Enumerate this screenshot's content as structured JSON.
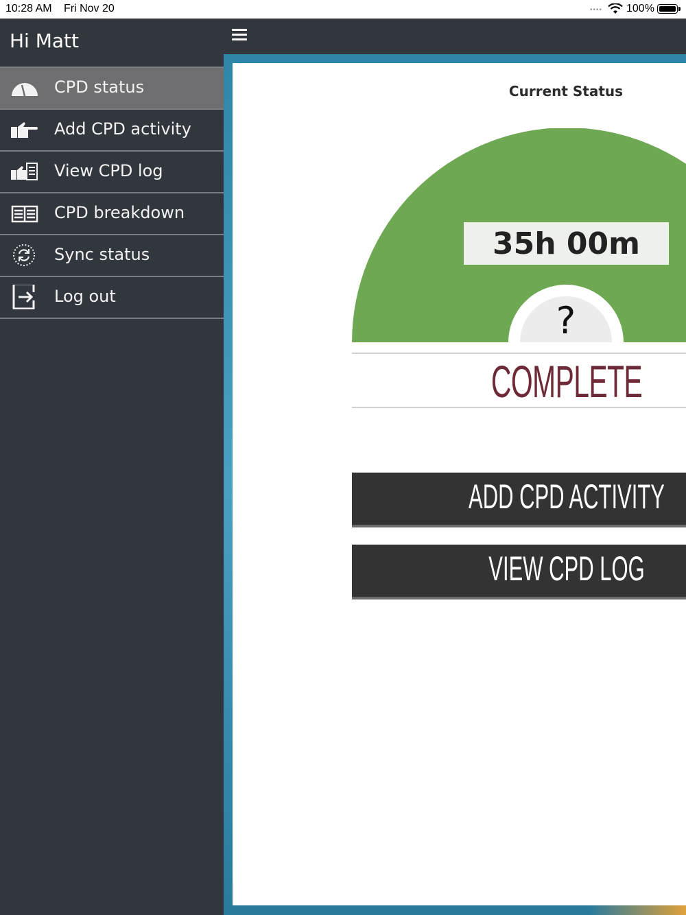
{
  "status_bar": {
    "time": "10:28 AM",
    "date": "Fri Nov 20",
    "battery": "100%"
  },
  "sidebar": {
    "greeting": "Hi Matt",
    "items": [
      {
        "label": "CPD status",
        "icon": "gauge-icon"
      },
      {
        "label": "Add CPD activity",
        "icon": "pointing-hand-icon"
      },
      {
        "label": "View CPD log",
        "icon": "hand-log-icon"
      },
      {
        "label": "CPD breakdown",
        "icon": "table-icon"
      },
      {
        "label": "Sync status",
        "icon": "sync-icon"
      },
      {
        "label": "Log out",
        "icon": "logout-icon"
      }
    ]
  },
  "main": {
    "title": "Current Status",
    "hours": "35h 00m",
    "help": "?",
    "status": "COMPLETE",
    "add_button": "ADD CPD ACTIVITY",
    "view_button": "VIEW CPD LOG"
  },
  "colors": {
    "sidebar_bg": "#32363d",
    "active_item": "#6f6f71",
    "gauge_green": "#6ea853",
    "status_text": "#6e2b37",
    "button_bg": "#333333",
    "frame": "#2f86a8"
  }
}
